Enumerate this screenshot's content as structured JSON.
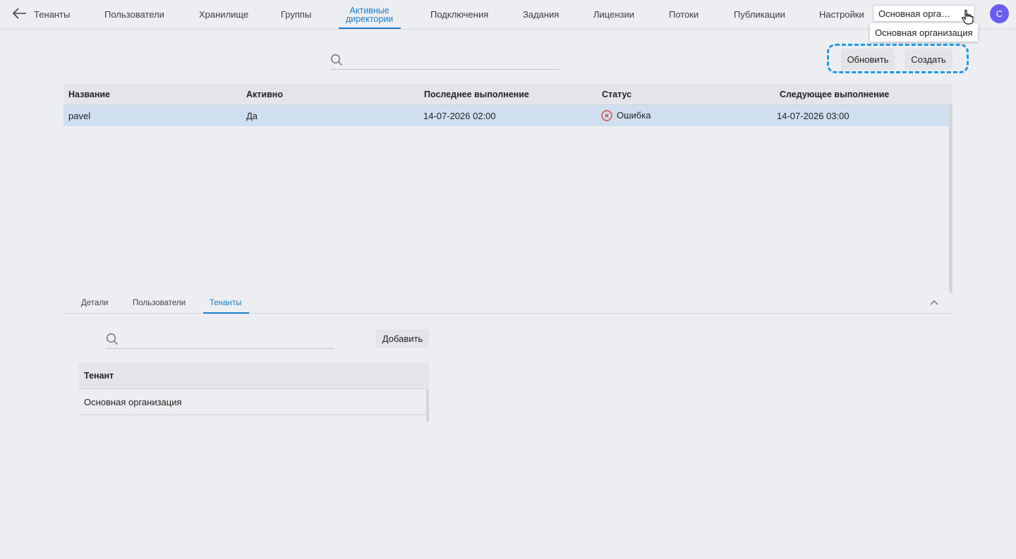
{
  "nav": {
    "back_label": "Тенанты",
    "items": [
      {
        "label": "Пользователи"
      },
      {
        "label": "Хранилище"
      },
      {
        "label": "Группы"
      },
      {
        "label": "Активные\nдиректории",
        "line1": "Активные",
        "line2": "директории",
        "active": true
      },
      {
        "label": "Подключения"
      },
      {
        "label": "Задания"
      },
      {
        "label": "Лицензии"
      },
      {
        "label": "Потоки"
      },
      {
        "label": "Публикации"
      },
      {
        "label": "Настройки"
      }
    ],
    "org_select_value": "Основная орга…",
    "avatar_initial": "C",
    "dropdown_option": "Основная организация"
  },
  "toolbar": {
    "search_placeholder": "",
    "refresh_label": "Обновить",
    "create_label": "Создать"
  },
  "table": {
    "columns": [
      "Название",
      "Активно",
      "Последнее выполнение",
      "Статус",
      "Следующее выполнение"
    ],
    "rows": [
      {
        "name": "pavel",
        "active": "Да",
        "last_run": "14-07-2026 02:00",
        "status": "Ошибка",
        "next_run": "14-07-2026 03:00",
        "selected": true
      }
    ]
  },
  "detail_tabs": {
    "tabs": [
      "Детали",
      "Пользователи",
      "Тенанты"
    ],
    "active_tab": "Тенанты"
  },
  "tenants_panel": {
    "search_placeholder": "",
    "add_label": "Добавить",
    "column": "Тенант",
    "rows": [
      "Основная организация"
    ]
  },
  "colors": {
    "accent": "#1a7ec8",
    "selected_row": "#cfdff0",
    "error": "#d0312d",
    "avatar": "#6a5cf0",
    "highlight_dash": "#1e9ae0"
  }
}
